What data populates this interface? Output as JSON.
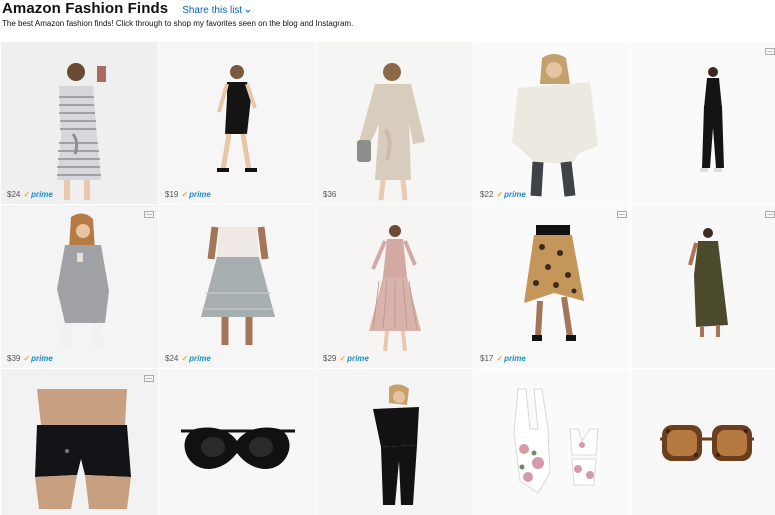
{
  "header": {
    "title": "Amazon Fashion Finds",
    "share_label": "Share this list",
    "description": "The best Amazon fashion finds! Click through to shop my favorites seen on the blog and Instagram."
  },
  "colors": {
    "link": "#0066c0",
    "prime_blue": "#1b8ccf",
    "prime_check": "#f3a847",
    "card_bg": "#f7f7f7"
  },
  "products": [
    {
      "price": "$24",
      "prime": "prime",
      "item": "striped-tie-waist-dress"
    },
    {
      "price": "$19",
      "prime": "prime",
      "item": "black-tshirt-dress"
    },
    {
      "price": "$36",
      "prime": "",
      "item": "beige-wrap-sweater-dress"
    },
    {
      "price": "$22",
      "prime": "prime",
      "item": "white-off-shoulder-sweater"
    },
    {
      "price": "",
      "prime": "",
      "item": "black-jumpsuit"
    },
    {
      "price": "$39",
      "prime": "prime",
      "item": "grey-wrap-cardigan"
    },
    {
      "price": "$24",
      "prime": "prime",
      "item": "grey-tiered-skirt"
    },
    {
      "price": "$29",
      "prime": "prime",
      "item": "pink-pleated-wrap-dress"
    },
    {
      "price": "$17",
      "prime": "prime",
      "item": "leopard-print-skirt"
    },
    {
      "price": "",
      "prime": "",
      "item": "olive-wrap-maxi-dress"
    },
    {
      "price": "",
      "prime": "",
      "item": "black-running-shorts"
    },
    {
      "price": "",
      "prime": "",
      "item": "heart-sunglasses"
    },
    {
      "price": "",
      "prime": "",
      "item": "black-off-shoulder-jumpsuit"
    },
    {
      "price": "",
      "prime": "",
      "item": "floral-matching-swimsuits"
    },
    {
      "price": "",
      "prime": "",
      "item": "tortoise-square-sunglasses"
    }
  ],
  "prime_check": "✓"
}
